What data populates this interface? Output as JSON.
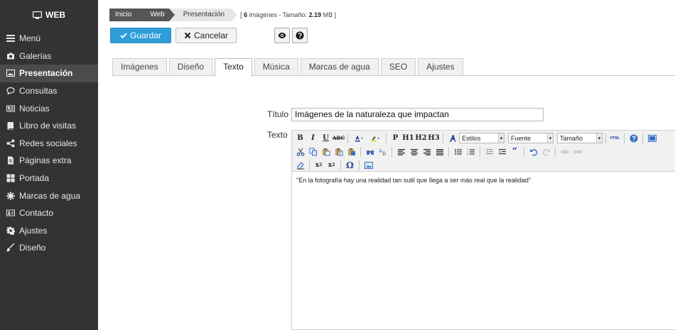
{
  "sidebar": {
    "brand": "WEB",
    "items": [
      {
        "label": "Menú",
        "icon": "menu-icon"
      },
      {
        "label": "Galerías",
        "icon": "camera-icon"
      },
      {
        "label": "Presentación",
        "icon": "image-icon"
      },
      {
        "label": "Consultas",
        "icon": "chat-icon"
      },
      {
        "label": "Noticias",
        "icon": "newspaper-icon"
      },
      {
        "label": "Libro de visitas",
        "icon": "book-icon"
      },
      {
        "label": "Redes sociales",
        "icon": "share-icon"
      },
      {
        "label": "Páginas extra",
        "icon": "file-icon"
      },
      {
        "label": "Portada",
        "icon": "grid-icon"
      },
      {
        "label": "Marcas de agua",
        "icon": "drop-icon"
      },
      {
        "label": "Contacto",
        "icon": "contact-card-icon"
      },
      {
        "label": "Ajustes",
        "icon": "gear-icon"
      },
      {
        "label": "Diseño",
        "icon": "brush-icon"
      }
    ],
    "active": "Presentación"
  },
  "breadcrumb": {
    "items": [
      "Inicio",
      "Web",
      "Presentación"
    ],
    "info": {
      "open": "[",
      "count": "6",
      "count_suffix": "imágenes - Tamaño:",
      "size": "2.19",
      "size_unit": "MB ]"
    }
  },
  "actions": {
    "save_label": "Guardar",
    "cancel_label": "Cancelar",
    "preview_icon": "eye-icon",
    "help_icon": "question-icon"
  },
  "tabs": [
    "Imágenes",
    "Diseño",
    "Texto",
    "Música",
    "Marcas de agua",
    "SEO",
    "Ajustes"
  ],
  "active_tab": "Texto",
  "form": {
    "title_label": "Título",
    "title_value": "Imágenes de la naturaleza que impactan",
    "text_label": "Texto"
  },
  "editor": {
    "styles_label": "Estilos",
    "font_label": "Fuente",
    "size_label": "Tamaño",
    "content": "\"En la fotografía hay una realidad tan sutil que llega a ser más real que la realidad\""
  },
  "colors": {
    "sidebar": "#333333",
    "active": "#4b4b4b",
    "primary": "#2e9ed8"
  }
}
